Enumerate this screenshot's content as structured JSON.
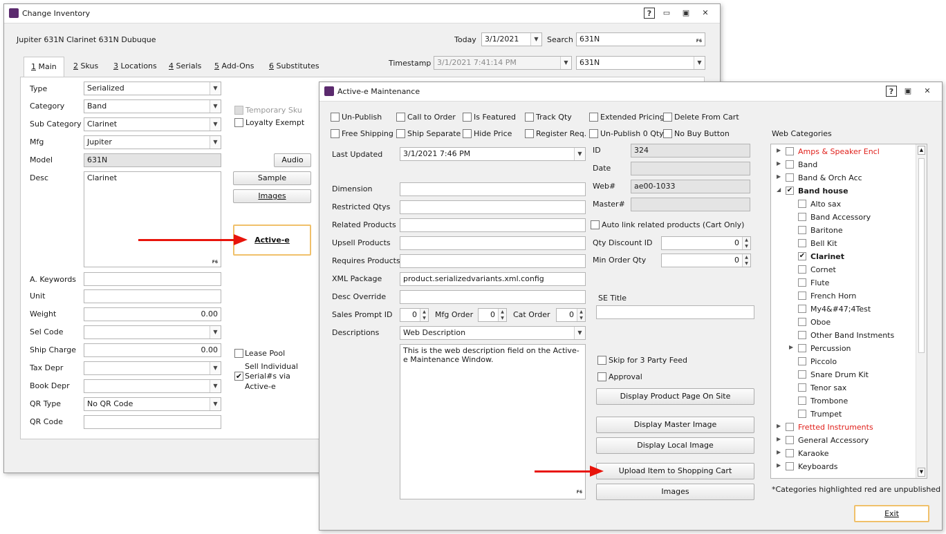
{
  "change_inventory": {
    "title": "Change Inventory",
    "item_header": "Jupiter 631N Clarinet 631N Dubuque",
    "today_label": "Today",
    "today_value": "3/1/2021",
    "search_label": "Search",
    "search_value": "631N",
    "timestamp_label": "Timestamp",
    "timestamp_value": "3/1/2021 7:41:14 PM",
    "timestamp_filter": "631N",
    "tabs": [
      {
        "num": "1",
        "label": " Main"
      },
      {
        "num": "2",
        "label": " Skus"
      },
      {
        "num": "3",
        "label": " Locations"
      },
      {
        "num": "4",
        "label": " Serials"
      },
      {
        "num": "5",
        "label": " Add-Ons"
      },
      {
        "num": "6",
        "label": " Substitutes"
      }
    ],
    "fields": {
      "type_label": "Type",
      "type_value": "Serialized",
      "category_label": "Category",
      "category_value": "Band",
      "subcategory_label": "Sub Category",
      "subcategory_value": "Clarinet",
      "mfg_label": "Mfg",
      "mfg_value": "Jupiter",
      "model_label": "Model",
      "model_value": "631N",
      "desc_label": "Desc",
      "desc_value": "Clarinet",
      "akeywords_label": "A. Keywords",
      "akeywords_value": "",
      "unit_label": "Unit",
      "unit_value": "",
      "weight_label": "Weight",
      "weight_value": "0.00",
      "selcode_label": "Sel Code",
      "selcode_value": "",
      "shipcharge_label": "Ship Charge",
      "shipcharge_value": "0.00",
      "taxdepr_label": "Tax Depr",
      "taxdepr_value": "",
      "bookdepr_label": "Book Depr",
      "bookdepr_value": "",
      "qrtype_label": "QR Type",
      "qrtype_value": "No QR Code",
      "qrcode_label": "QR Code",
      "qrcode_value": ""
    },
    "temporary_sku": "Temporary Sku",
    "loyalty_exempt": "Loyalty Exempt",
    "audio_btn": "Audio",
    "sample_btn": "Sample",
    "images_btn": "Images",
    "activee_btn": "Active-e",
    "lease_pool": "Lease Pool",
    "sell_individual": [
      "Sell Individual",
      "Serial#s via",
      "Active-e"
    ],
    "f6": "F6"
  },
  "activee": {
    "title": "Active-e Maintenance",
    "checks_row1": [
      {
        "label": "Un-Publish",
        "checked": false
      },
      {
        "label": "Call to Order",
        "checked": false
      },
      {
        "label": "Is Featured",
        "checked": false
      },
      {
        "label": "Track Qty",
        "checked": false
      },
      {
        "label": "Extended Pricing",
        "checked": false
      },
      {
        "label": "Delete From Cart",
        "checked": false
      }
    ],
    "checks_row2": [
      {
        "label": "Free Shipping",
        "checked": false
      },
      {
        "label": "Ship Separate",
        "checked": false
      },
      {
        "label": "Hide Price",
        "checked": false
      },
      {
        "label": "Register Req.",
        "checked": false
      },
      {
        "label": "Un-Publish 0 Qty",
        "checked": false
      },
      {
        "label": "No Buy Button",
        "checked": false
      }
    ],
    "last_updated_label": "Last Updated",
    "last_updated_value": "3/1/2021 7:46 PM",
    "id_label": "ID",
    "id_value": "324",
    "date_label": "Date",
    "date_value": "",
    "web_label": "Web#",
    "web_value": "ae00-1033",
    "master_label": "Master#",
    "master_value": "",
    "dimension_label": "Dimension",
    "restricted_label": "Restricted Qtys",
    "related_label": "Related Products",
    "upsell_label": "Upsell Products",
    "requires_label": "Requires Products",
    "xml_label": "XML Package",
    "xml_value": "product.serializedvariants.xml.config",
    "desc_override_label": "Desc Override",
    "sales_prompt_label": "Sales Prompt ID",
    "sales_prompt_value": "0",
    "mfg_order_label": "Mfg Order",
    "mfg_order_value": "0",
    "cat_order_label": "Cat Order",
    "cat_order_value": "0",
    "descriptions_label": "Descriptions",
    "descriptions_value": "Web Description",
    "description_text": "This is the web description field on the Active-e Maintenance Window.",
    "auto_link": "Auto link related products (Cart Only)",
    "qty_discount_label": "Qty Discount ID",
    "qty_discount_value": "0",
    "min_order_label": "Min Order Qty",
    "min_order_value": "0",
    "se_title_label": "SE Title",
    "skip_3party": "Skip for 3 Party Feed",
    "approval": "Approval",
    "btn_display_product": "Display Product Page On Site",
    "btn_display_master": "Display Master Image",
    "btn_display_local": "Display Local Image",
    "btn_upload": "Upload Item to Shopping Cart",
    "btn_images": "Images",
    "web_categories_label": "Web Categories",
    "categories": [
      {
        "label": "Amps & Speaker Encl",
        "level": 0,
        "expander": "▶",
        "checked": false,
        "red": true,
        "bold": false
      },
      {
        "label": "Band",
        "level": 0,
        "expander": "▶",
        "checked": false,
        "red": false,
        "bold": false
      },
      {
        "label": "Band & Orch Acc",
        "level": 0,
        "expander": "▶",
        "checked": false,
        "red": false,
        "bold": false
      },
      {
        "label": "Band house",
        "level": 0,
        "expander": "◢",
        "checked": true,
        "red": false,
        "bold": true
      },
      {
        "label": "Alto sax",
        "level": 1,
        "expander": "",
        "checked": false,
        "red": false,
        "bold": false
      },
      {
        "label": "Band Accessory",
        "level": 1,
        "expander": "",
        "checked": false,
        "red": false,
        "bold": false
      },
      {
        "label": "Baritone",
        "level": 1,
        "expander": "",
        "checked": false,
        "red": false,
        "bold": false
      },
      {
        "label": "Bell Kit",
        "level": 1,
        "expander": "",
        "checked": false,
        "red": false,
        "bold": false
      },
      {
        "label": "Clarinet",
        "level": 1,
        "expander": "",
        "checked": true,
        "red": false,
        "bold": true
      },
      {
        "label": "Cornet",
        "level": 1,
        "expander": "",
        "checked": false,
        "red": false,
        "bold": false
      },
      {
        "label": "Flute",
        "level": 1,
        "expander": "",
        "checked": false,
        "red": false,
        "bold": false
      },
      {
        "label": "French Horn",
        "level": 1,
        "expander": "",
        "checked": false,
        "red": false,
        "bold": false
      },
      {
        "label": "My4&#47;4Test",
        "level": 1,
        "expander": "",
        "checked": false,
        "red": false,
        "bold": false
      },
      {
        "label": "Oboe",
        "level": 1,
        "expander": "",
        "checked": false,
        "red": false,
        "bold": false
      },
      {
        "label": "Other Band Instments",
        "level": 1,
        "expander": "",
        "checked": false,
        "red": false,
        "bold": false
      },
      {
        "label": "Percussion",
        "level": 1,
        "expander": "▶",
        "checked": false,
        "red": false,
        "bold": false
      },
      {
        "label": "Piccolo",
        "level": 1,
        "expander": "",
        "checked": false,
        "red": false,
        "bold": false
      },
      {
        "label": "Snare Drum Kit",
        "level": 1,
        "expander": "",
        "checked": false,
        "red": false,
        "bold": false
      },
      {
        "label": "Tenor sax",
        "level": 1,
        "expander": "",
        "checked": false,
        "red": false,
        "bold": false
      },
      {
        "label": "Trombone",
        "level": 1,
        "expander": "",
        "checked": false,
        "red": false,
        "bold": false
      },
      {
        "label": "Trumpet",
        "level": 1,
        "expander": "",
        "checked": false,
        "red": false,
        "bold": false
      },
      {
        "label": "Fretted Instruments",
        "level": 0,
        "expander": "▶",
        "checked": false,
        "red": true,
        "bold": false
      },
      {
        "label": "General Accessory",
        "level": 0,
        "expander": "▶",
        "checked": false,
        "red": false,
        "bold": false
      },
      {
        "label": "Karaoke",
        "level": 0,
        "expander": "▶",
        "checked": false,
        "red": false,
        "bold": false
      },
      {
        "label": "Keyboards",
        "level": 0,
        "expander": "▶",
        "checked": false,
        "red": false,
        "bold": false
      }
    ],
    "categories_note": "*Categories highlighted red are unpublished",
    "exit_btn": "Exit",
    "f6": "F6"
  },
  "colors": {
    "arrow": "#e8140b",
    "unpublished": "#e0201b",
    "app_icon": "#5b2a6e"
  }
}
